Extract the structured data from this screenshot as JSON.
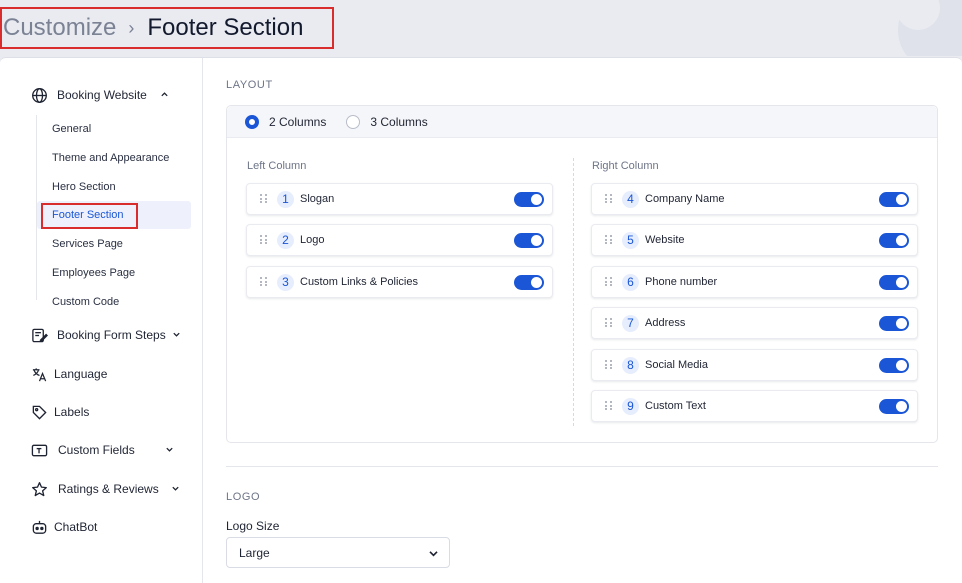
{
  "breadcrumb": {
    "parent": "Customize",
    "separator": "›",
    "current": "Footer Section"
  },
  "sidebar": {
    "booking_website": "Booking Website",
    "sub_items": [
      "General",
      "Theme and Appearance",
      "Hero Section",
      "Footer Section",
      "Services Page",
      "Employees Page",
      "Custom Code"
    ],
    "active_sub_item": "Footer Section",
    "booking_form_steps": "Booking Form Steps",
    "language": "Language",
    "labels": "Labels",
    "custom_fields": "Custom Fields",
    "ratings_reviews": "Ratings & Reviews",
    "chatbot": "ChatBot"
  },
  "layout": {
    "title": "LAYOUT",
    "options": [
      "2 Columns",
      "3 Columns"
    ],
    "selected": "2 Columns",
    "left_column": {
      "heading": "Left Column",
      "items": [
        {
          "num": "1",
          "label": "Slogan",
          "enabled": true
        },
        {
          "num": "2",
          "label": "Logo",
          "enabled": true
        },
        {
          "num": "3",
          "label": "Custom Links & Policies",
          "enabled": true
        }
      ]
    },
    "right_column": {
      "heading": "Right Column",
      "items": [
        {
          "num": "4",
          "label": "Company Name",
          "enabled": true
        },
        {
          "num": "5",
          "label": "Website",
          "enabled": true
        },
        {
          "num": "6",
          "label": "Phone number",
          "enabled": true
        },
        {
          "num": "7",
          "label": "Address",
          "enabled": true
        },
        {
          "num": "8",
          "label": "Social Media",
          "enabled": true
        },
        {
          "num": "9",
          "label": "Custom Text",
          "enabled": true
        }
      ]
    }
  },
  "logo": {
    "title": "LOGO",
    "size_label": "Logo Size",
    "size_value": "Large"
  },
  "colors": {
    "accent": "#1a56d6",
    "highlight": "#d92d2d"
  }
}
